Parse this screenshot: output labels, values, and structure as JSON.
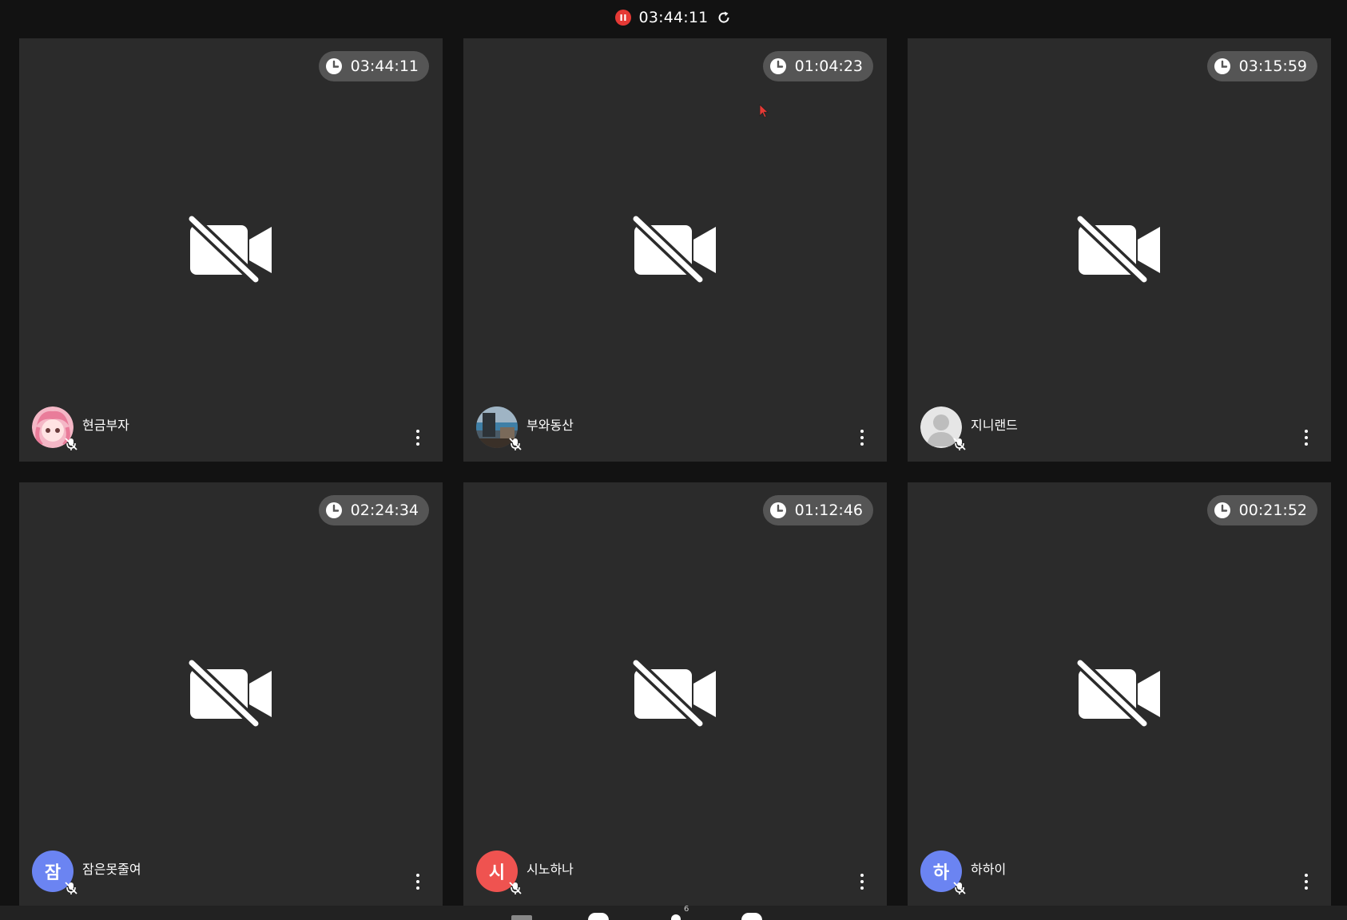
{
  "app": {
    "recording_timer": "03:44:11",
    "accent_color": "#e53935"
  },
  "icons": {
    "record": "pause-record-icon",
    "refresh": "refresh-icon",
    "clock": "clock-icon",
    "camera_off": "video-camera-off-icon",
    "mic_off": "microphone-off-icon",
    "more": "more-vertical-icon"
  },
  "participants": [
    {
      "name": "현금부자",
      "timer": "03:44:11",
      "avatar_type": "image",
      "avatar_desc": "pink anime character"
    },
    {
      "name": "부와동산",
      "timer": "01:04:23",
      "avatar_type": "image",
      "avatar_desc": "seaside photo"
    },
    {
      "name": "지니랜드",
      "timer": "03:15:59",
      "avatar_type": "image",
      "avatar_desc": "default user silhouette"
    },
    {
      "name": "잠은못줄여",
      "timer": "02:24:34",
      "avatar_type": "initial",
      "initial": "잠",
      "avatar_color": "#6b84f2"
    },
    {
      "name": "시노하나",
      "timer": "01:12:46",
      "avatar_type": "initial",
      "initial": "시",
      "avatar_color": "#ef5350"
    },
    {
      "name": "하하이",
      "timer": "00:21:52",
      "avatar_type": "initial",
      "initial": "하",
      "avatar_color": "#6b84f2"
    }
  ],
  "dock": {
    "participant_count": "6"
  }
}
